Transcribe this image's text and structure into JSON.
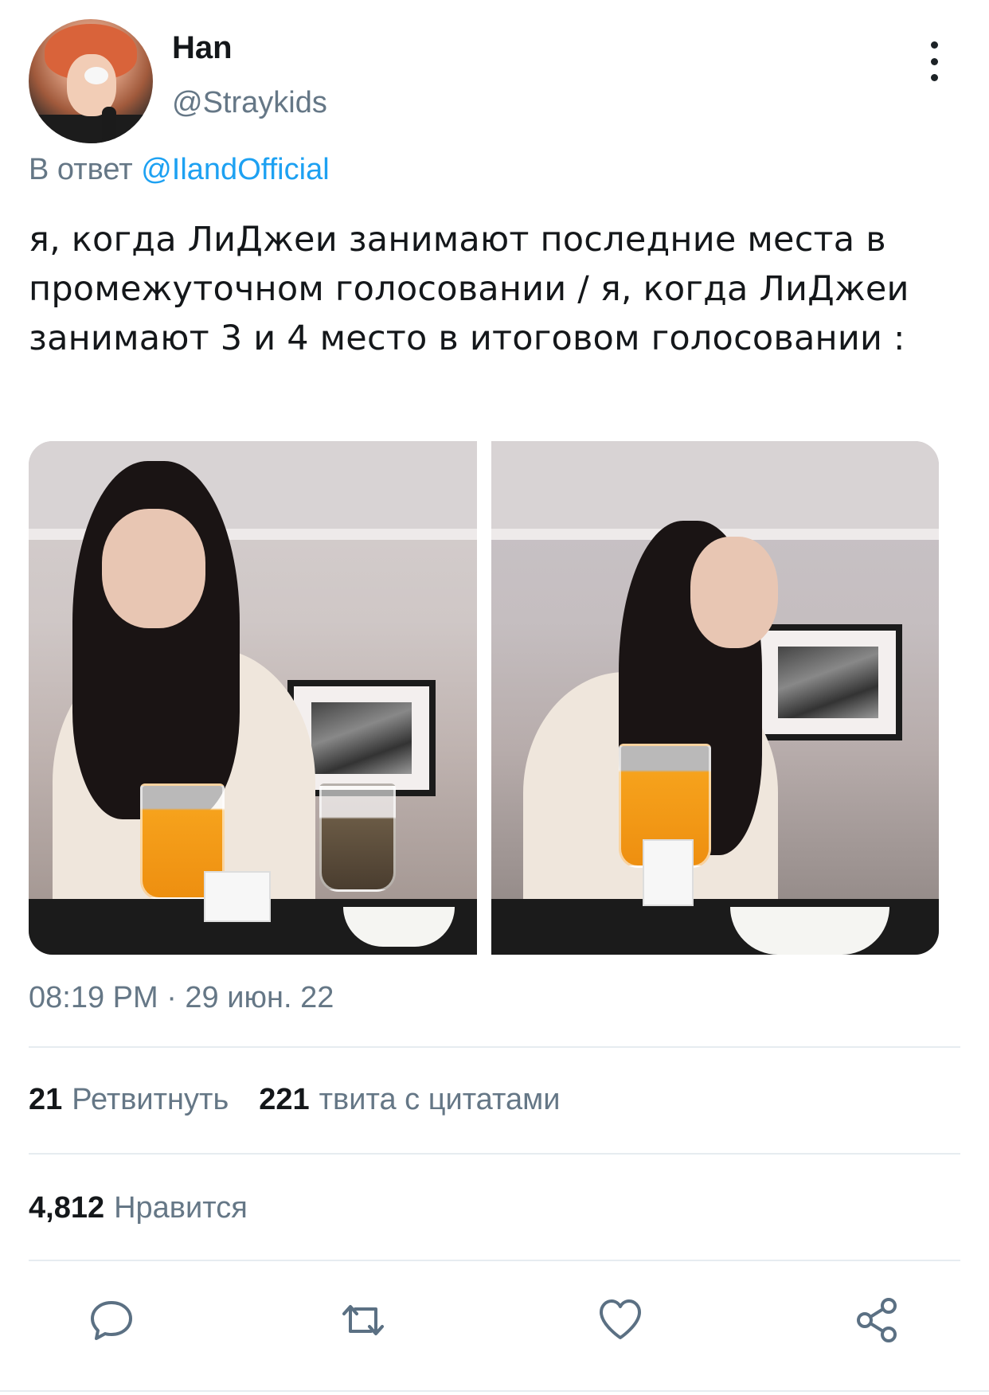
{
  "author": {
    "display_name": "Han",
    "handle": "@Straykids"
  },
  "reply": {
    "prefix": "В ответ",
    "mention": "@IlandOfficial"
  },
  "tweet": {
    "text": "я, когда ЛиДжеи занимают последние места в промежуточном голосовании / я, когда ЛиДжеи занимают 3 и 4 место в итоговом голосовании :"
  },
  "meta": {
    "timestamp": "08:19 PM · 29 июн. 22"
  },
  "stats": {
    "retweets_count": "21",
    "retweets_label": "Ретвитнуть",
    "quotes_count": "221",
    "quotes_label": "твита с цитатами",
    "likes_count": "4,812",
    "likes_label": "Нравится"
  },
  "actions": {
    "reply_icon": "reply-icon",
    "retweet_icon": "retweet-icon",
    "like_icon": "heart-icon",
    "share_icon": "share-icon"
  },
  "colors": {
    "link": "#1da1f2",
    "muted": "#657786",
    "text": "#14171a",
    "divider": "#e6ecf0",
    "icon": "#5b7083"
  }
}
